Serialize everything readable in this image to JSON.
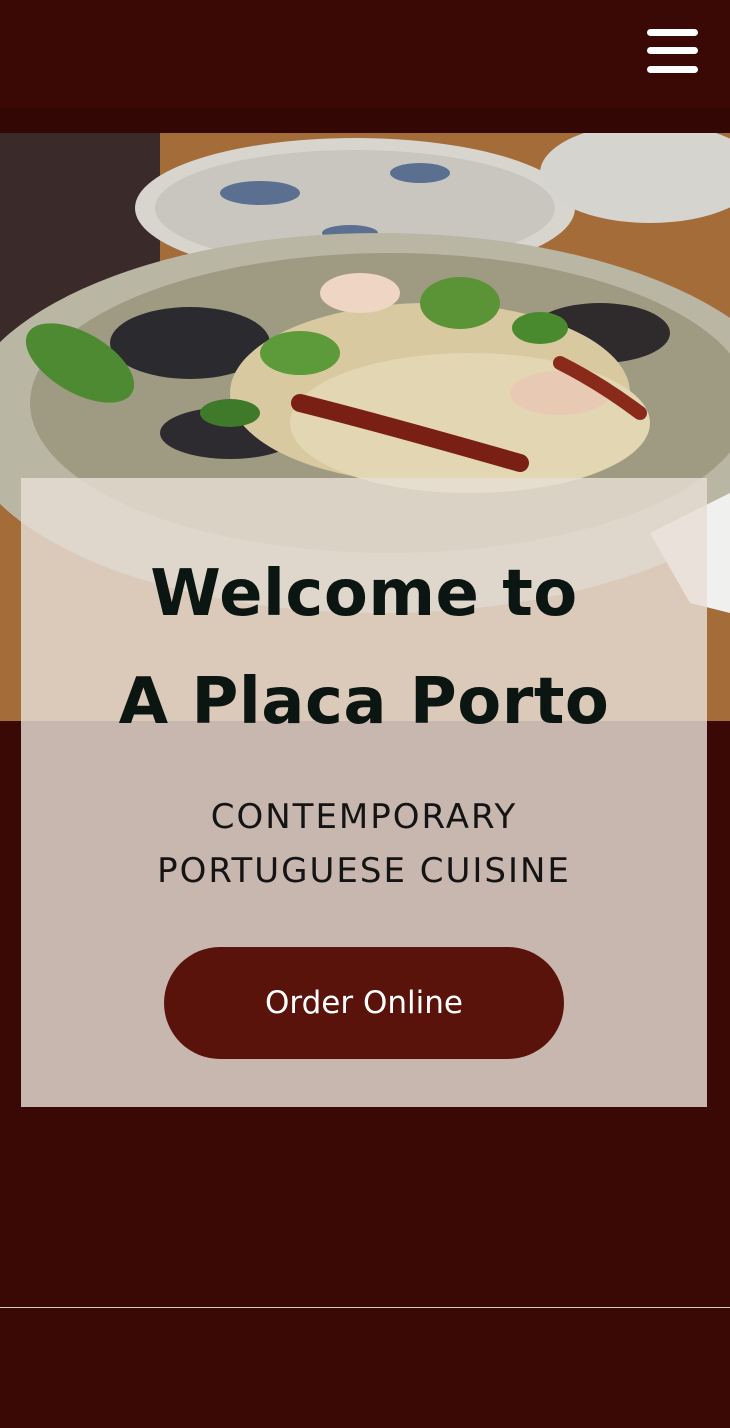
{
  "header": {
    "menu_icon": "hamburger-menu-icon"
  },
  "hero": {
    "image_alt": "Plate of seafood spaghetti with herbs and dried chili"
  },
  "welcome": {
    "title_line1": "Welcome to",
    "title_line2": "A Placa Porto",
    "subtitle_line1": "CONTEMPORARY",
    "subtitle_line2": "PORTUGUESE CUISINE",
    "order_label": "Order Online"
  },
  "colors": {
    "background": "#3a0805",
    "button": "#5a130b",
    "card": "#e8ded6"
  }
}
